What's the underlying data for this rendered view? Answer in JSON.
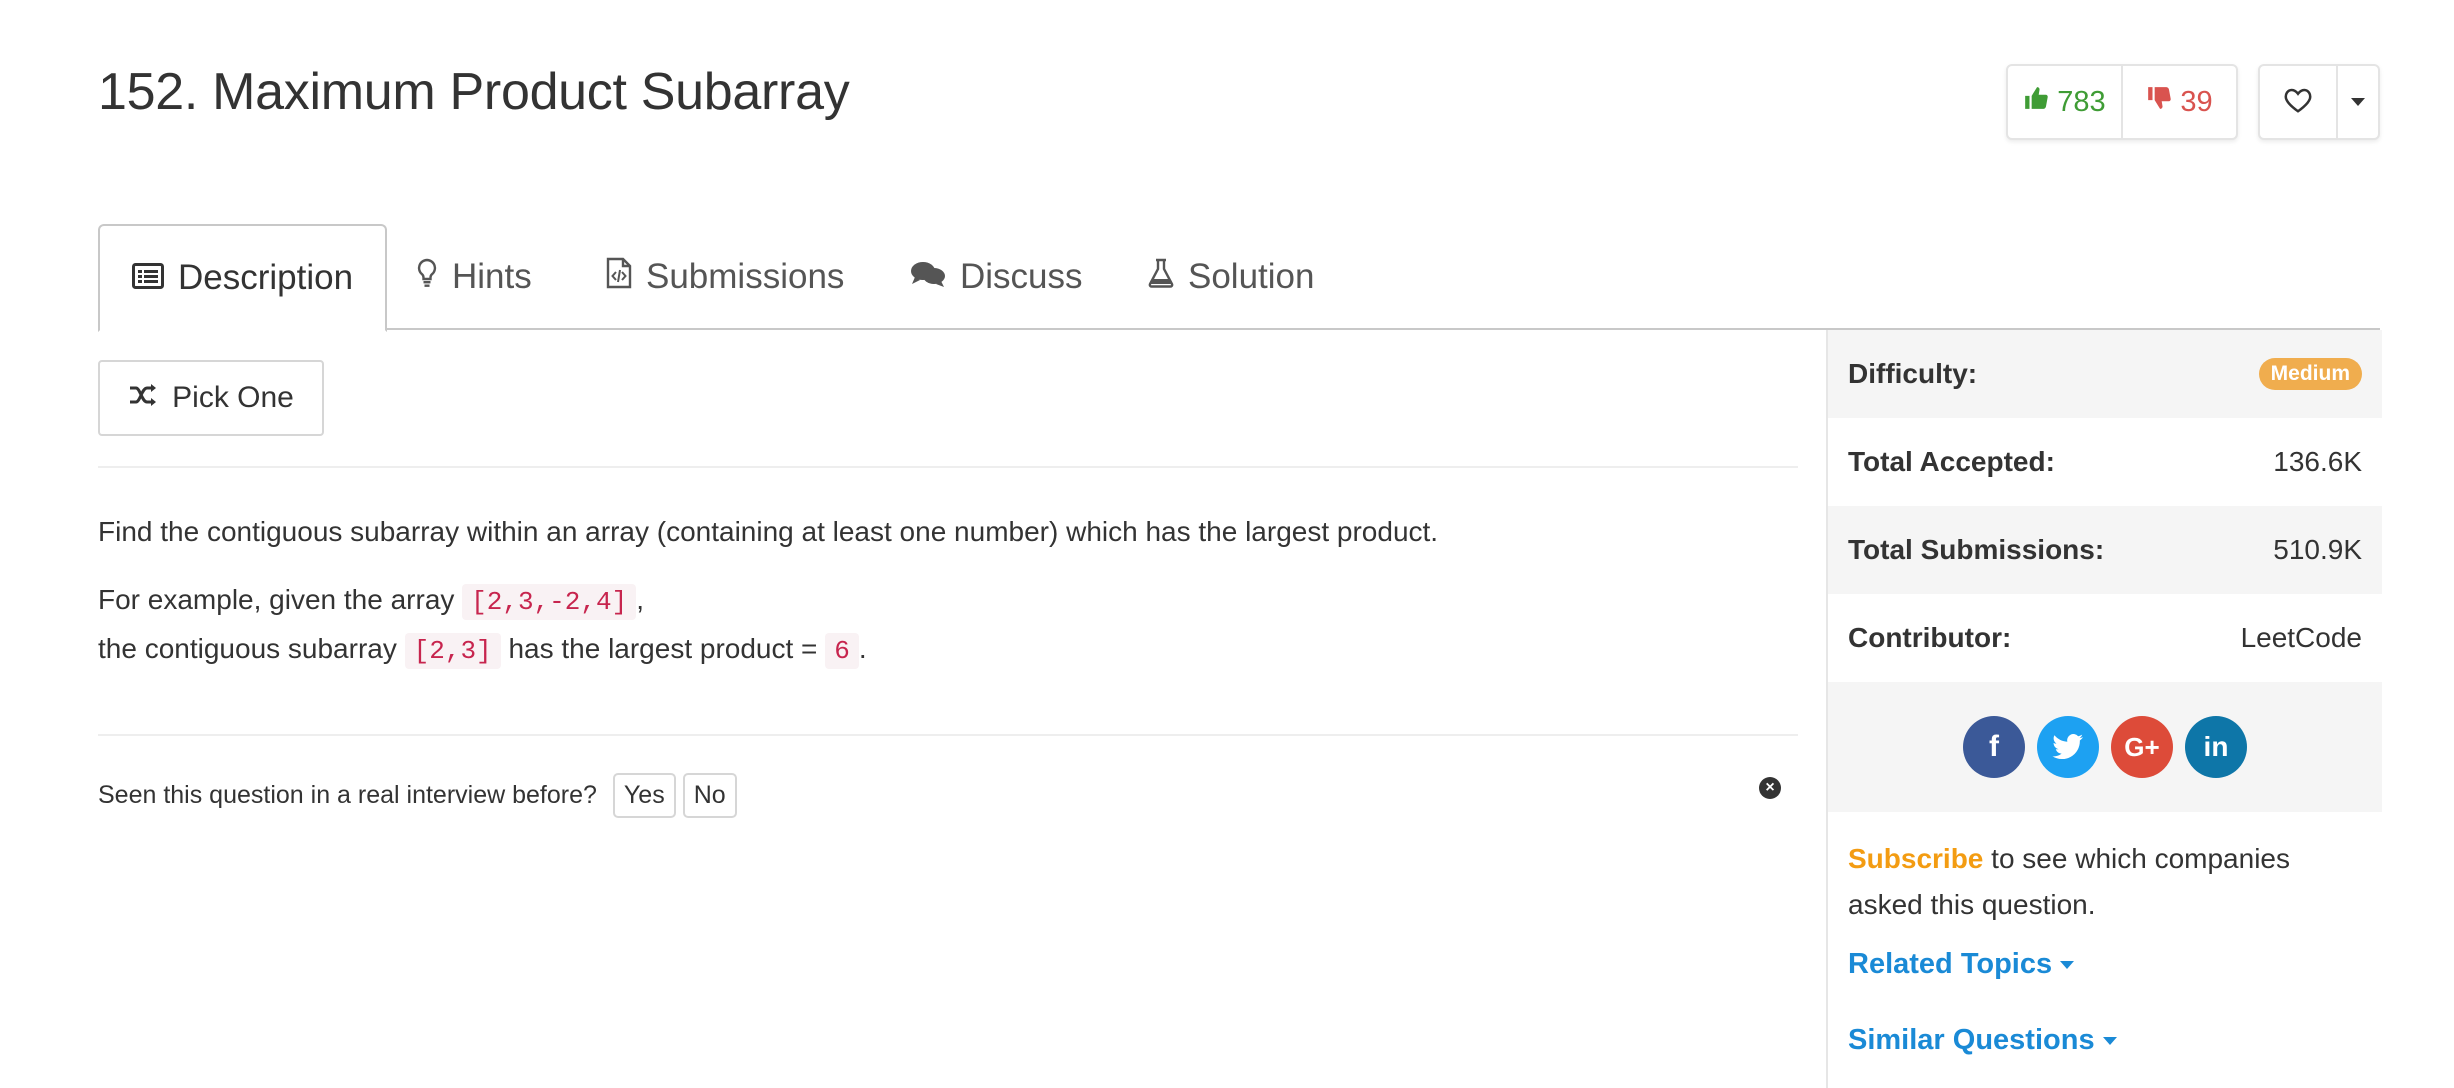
{
  "problem": {
    "title": "152. Maximum Product Subarray"
  },
  "votes": {
    "likes": "783",
    "dislikes": "39"
  },
  "colors": {
    "like": "#3f9c35",
    "dislike": "#d9534f",
    "link": "#1a8ad6",
    "subscribe": "#f39c12",
    "medium_badge": "#f0ad4e",
    "code_text": "#c7254e",
    "code_bg": "#f9f2f4"
  },
  "tabs": [
    {
      "label": "Description",
      "icon": "list-icon",
      "active": true
    },
    {
      "label": "Hints",
      "icon": "lightbulb-icon",
      "active": false
    },
    {
      "label": "Submissions",
      "icon": "code-file-icon",
      "active": false
    },
    {
      "label": "Discuss",
      "icon": "comments-icon",
      "active": false
    },
    {
      "label": "Solution",
      "icon": "flask-icon",
      "active": false
    }
  ],
  "pick_one": {
    "label": "Pick One",
    "icon": "shuffle-icon"
  },
  "description": {
    "para1": "Find the contiguous subarray within an array (containing at least one number) which has the largest product.",
    "line2_pre": "For example, given the array",
    "line2_code": "[2,3,-2,4]",
    "line2_post": ",",
    "line3_pre": "the contiguous subarray",
    "line3_code": "[2,3]",
    "line3_mid": "has the largest product =",
    "line3_code2": "6",
    "line3_post": "."
  },
  "interview": {
    "question": "Seen this question in a real interview before?",
    "yes": "Yes",
    "no": "No"
  },
  "sidebar": {
    "difficulty_label": "Difficulty:",
    "difficulty_value": "Medium",
    "accepted_label": "Total Accepted:",
    "accepted_value": "136.6K",
    "submissions_label": "Total Submissions:",
    "submissions_value": "510.9K",
    "contributor_label": "Contributor:",
    "contributor_value": "LeetCode",
    "social": [
      {
        "name": "facebook",
        "glyph": "f",
        "color": "#3b5998"
      },
      {
        "name": "twitter",
        "glyph": "t",
        "color": "#1da1f2"
      },
      {
        "name": "google-plus",
        "glyph": "G+",
        "color": "#dd4b39"
      },
      {
        "name": "linkedin",
        "glyph": "in",
        "color": "#0e76a8"
      }
    ],
    "subscribe_link": "Subscribe",
    "subscribe_text": "to see which companies asked this question.",
    "related_topics": "Related Topics",
    "similar_questions": "Similar Questions"
  }
}
